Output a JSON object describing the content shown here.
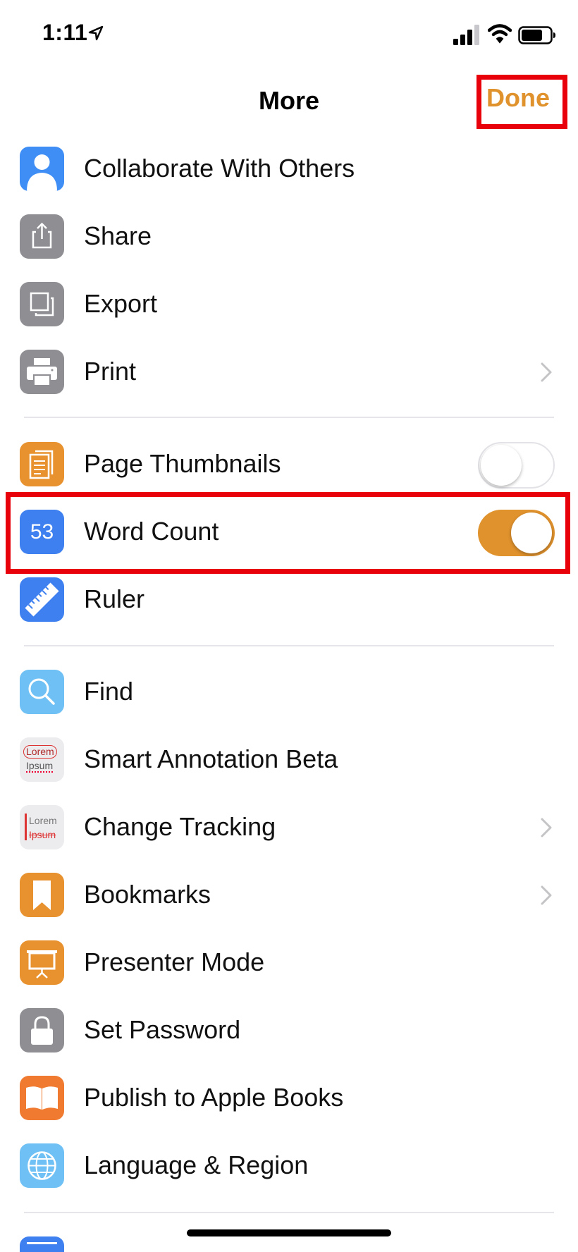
{
  "status_bar": {
    "time": "1:11"
  },
  "nav": {
    "title": "More",
    "done_label": "Done",
    "accent": "#e0922d"
  },
  "items": [
    {
      "label": "Collaborate With Others",
      "icon": "collaborate-icon"
    },
    {
      "label": "Share",
      "icon": "share-icon"
    },
    {
      "label": "Export",
      "icon": "export-icon"
    },
    {
      "label": "Print",
      "icon": "print-icon",
      "chevron": true
    },
    {
      "label": "Page Thumbnails",
      "icon": "page-thumbnails-icon",
      "toggle": false
    },
    {
      "label": "Word Count",
      "icon": "word-count-icon",
      "badge": "53",
      "toggle": true
    },
    {
      "label": "Ruler",
      "icon": "ruler-icon"
    },
    {
      "label": "Find",
      "icon": "search-icon"
    },
    {
      "label": "Smart Annotation Beta",
      "icon": "smart-annotation-icon",
      "icon_text": [
        "Lorem",
        "Ipsum"
      ]
    },
    {
      "label": "Change Tracking",
      "icon": "change-tracking-icon",
      "icon_text": [
        "Lorem",
        "Ipsum"
      ],
      "chevron": true
    },
    {
      "label": "Bookmarks",
      "icon": "bookmark-icon",
      "chevron": true
    },
    {
      "label": "Presenter Mode",
      "icon": "presenter-icon"
    },
    {
      "label": "Set Password",
      "icon": "lock-icon"
    },
    {
      "label": "Publish to Apple Books",
      "icon": "book-icon"
    },
    {
      "label": "Language & Region",
      "icon": "globe-icon"
    }
  ]
}
